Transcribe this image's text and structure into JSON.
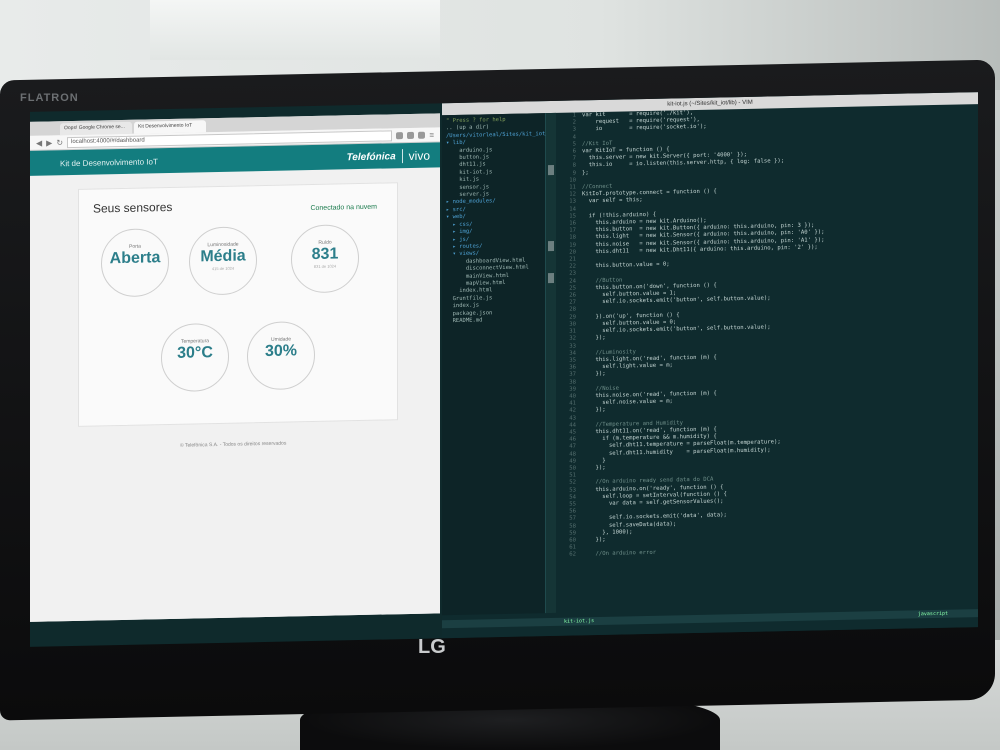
{
  "monitor": {
    "brand_top": "FLATRON",
    "logo": "LG"
  },
  "browser": {
    "tabs": [
      "Oops! Google Chrome se...",
      "Kit Desenvolvimento IoT"
    ],
    "url": "localhost:4000/#/dashboard",
    "app_title": "Kit de Desenvolvimento IoT",
    "brand1": "Telefónica",
    "brand2": "vivo"
  },
  "dashboard": {
    "title": "Seus sensores",
    "status": "Conectado na nuvem",
    "gauges": [
      {
        "label": "Porta",
        "value": "Aberta",
        "sub": ""
      },
      {
        "label": "Luminosidade",
        "value": "Média",
        "sub": "415 de 1024"
      },
      {
        "label": "Ruído",
        "value": "831",
        "sub": "831 de 1024"
      },
      {
        "label": "Temperatura",
        "value": "30°C",
        "sub": ""
      },
      {
        "label": "Umidade",
        "value": "30%",
        "sub": ""
      }
    ],
    "footer": "© Telefônica S.A. - Todos os direitos reservados"
  },
  "vim": {
    "title": "kit-iot.js (~/Sites/kit_iot/lib) - VIM",
    "tree": [
      "\" Press ? for help",
      "",
      ".. (up a dir)",
      "/Users/vitorleal/Sites/kit_iot/",
      "▾ lib/",
      "    arduino.js",
      "    button.js",
      "    dht11.js",
      "    kit-iot.js",
      "    kit.js",
      "    sensor.js",
      "    server.js",
      "▸ node_modules/",
      "▸ src/",
      "▾ web/",
      "  ▸ css/",
      "  ▸ img/",
      "  ▸ js/",
      "  ▸ routes/",
      "  ▾ views/",
      "      dashboardView.html",
      "      disconnectView.html",
      "      mainView.html",
      "      mapView.html",
      "    index.html",
      "  Gruntfile.js",
      "  index.js",
      "  package.json",
      "  README.md"
    ],
    "code": [
      "var kit       = require('./kit'),",
      "    request   = require('request'),",
      "    io        = require('socket.io');",
      "",
      "//Kit IoT",
      "var KitIoT = function () {",
      "  this.server = new kit.Server({ port: '4000' });",
      "  this.io     = io.listen(this.server.http, { log: false });",
      "};",
      "",
      "//Connect",
      "KitIoT.prototype.connect = function () {",
      "  var self = this;",
      "",
      "  if (!this.arduino) {",
      "    this.arduino = new kit.Arduino();",
      "    this.button  = new kit.Button({ arduino: this.arduino, pin: 3 });",
      "    this.light   = new kit.Sensor({ arduino: this.arduino, pin: 'A0' });",
      "    this.noise   = new kit.Sensor({ arduino: this.arduino, pin: 'A1' });",
      "    this.dht11   = new kit.Dht11({ arduino: this.arduino, pin: '2' });",
      "",
      "    this.button.value = 0;",
      "",
      "    //Button",
      "    this.button.on('down', function () {",
      "      self.button.value = 1;",
      "      self.io.sockets.emit('button', self.button.value);",
      "",
      "    }).on('up', function () {",
      "      self.button.value = 0;",
      "      self.io.sockets.emit('button', self.button.value);",
      "    });",
      "",
      "    //Luminosity",
      "    this.light.on('read', function (m) {",
      "      self.light.value = m;",
      "    });",
      "",
      "    //Noise",
      "    this.noise.on('read', function (m) {",
      "      self.noise.value = m;",
      "    });",
      "",
      "    //Temperature and Humidity",
      "    this.dht11.on('read', function (m) {",
      "      if (m.temperature && m.humidity) {",
      "        self.dht11.temperature = parseFloat(m.temperature);",
      "        self.dht11.humidity    = parseFloat(m.humidity);",
      "      }",
      "    });",
      "",
      "    //On arduino ready send data do DCA",
      "    this.arduino.on('ready', function () {",
      "      self.loop = setInterval(function () {",
      "        var data = self.getSensorValues();",
      "",
      "        self.io.sockets.emit('data', data);",
      "        self.saveData(data);",
      "      }, 1000);",
      "    });",
      "",
      "    //On arduino error"
    ],
    "statusline": "kit-iot.js",
    "filetype": "javascript"
  }
}
